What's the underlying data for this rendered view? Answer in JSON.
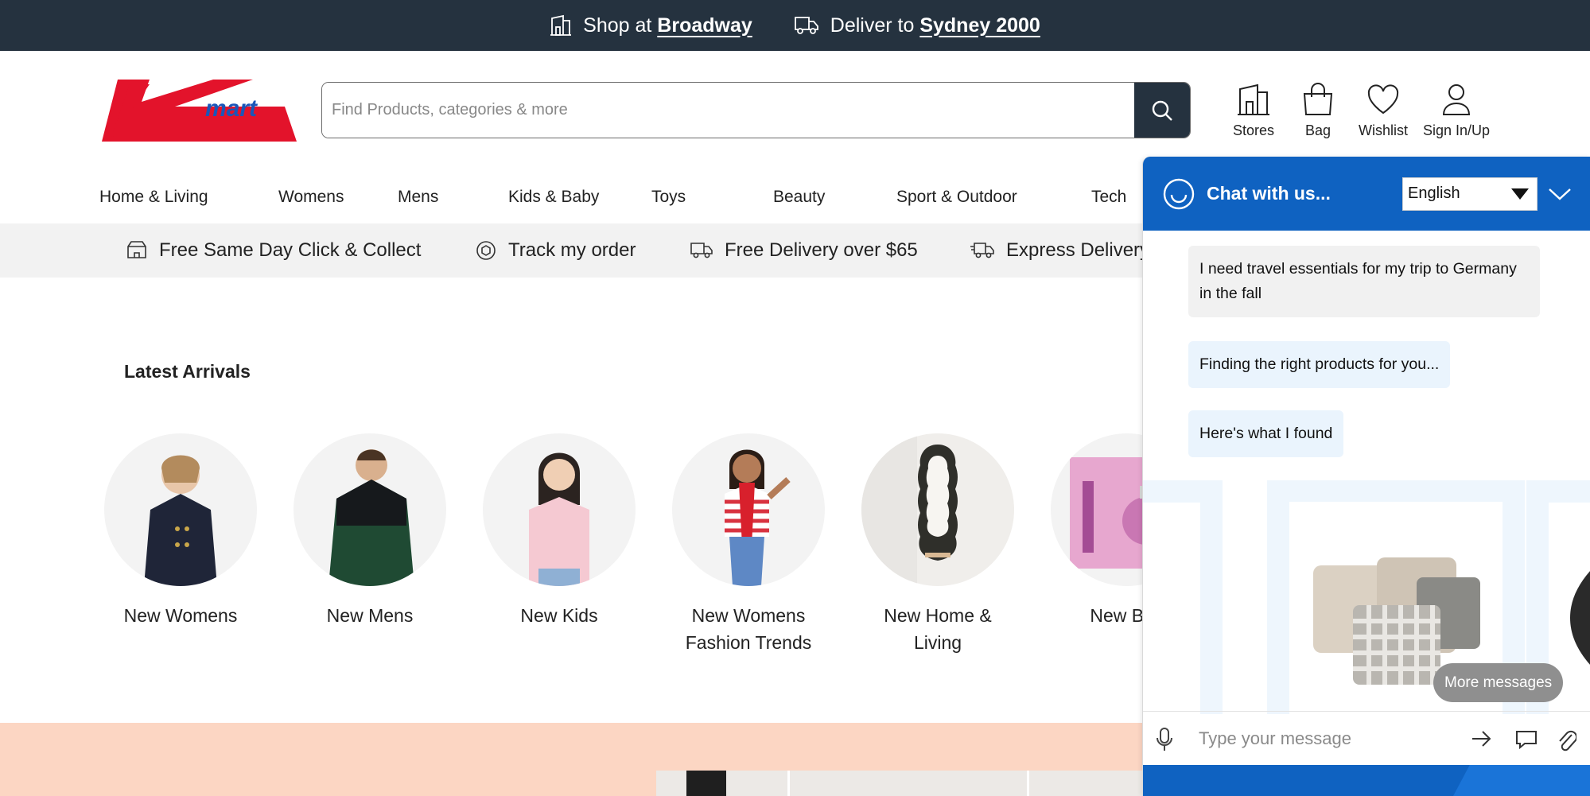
{
  "topbar": {
    "shop_prefix": "Shop at",
    "shop_store": "Broadway",
    "deliver_prefix": "Deliver to",
    "deliver_location": "Sydney 2000"
  },
  "header": {
    "logo_text": "mart",
    "search_placeholder": "Find Products, categories & more",
    "icons": [
      {
        "label": "Stores",
        "icon": "store-icon"
      },
      {
        "label": "Bag",
        "icon": "bag-icon"
      },
      {
        "label": "Wishlist",
        "icon": "heart-icon"
      },
      {
        "label": "Sign In/Up",
        "icon": "user-icon"
      }
    ]
  },
  "nav": {
    "items": [
      "Home & Living",
      "Womens",
      "Mens",
      "Kids & Baby",
      "Toys",
      "Beauty",
      "Sport & Outdoor",
      "Tech"
    ]
  },
  "benefits": [
    {
      "label": "Free Same Day Click & Collect",
      "icon": "click-collect-icon"
    },
    {
      "label": "Track my order",
      "icon": "track-icon"
    },
    {
      "label": "Free Delivery over $65",
      "icon": "delivery-truck-icon"
    },
    {
      "label": "Express Delivery",
      "icon": "express-truck-icon"
    }
  ],
  "latest": {
    "title": "Latest Arrivals",
    "categories": [
      {
        "label": "New Womens"
      },
      {
        "label": "New Mens"
      },
      {
        "label": "New Kids"
      },
      {
        "label": "New Womens Fashion Trends"
      },
      {
        "label": "New Home & Living"
      },
      {
        "label": "New Bea"
      }
    ]
  },
  "chat": {
    "title": "Chat with us...",
    "language": "English",
    "messages": [
      {
        "from": "user",
        "text": "I need travel essentials for my trip to Germany in the fall"
      },
      {
        "from": "bot",
        "text": "Finding the right products for you..."
      },
      {
        "from": "bot",
        "text": "Here's what I found"
      }
    ],
    "more_messages": "More messages",
    "input_placeholder": "Type your message"
  },
  "colors": {
    "topbar": "#25323f",
    "brand_red": "#e3132b",
    "chat_blue": "#0f62c1",
    "promo_peach": "#fcd6c3"
  }
}
